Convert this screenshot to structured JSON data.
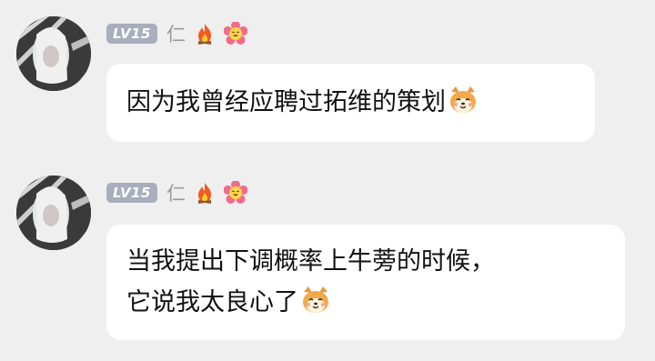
{
  "messages": [
    {
      "level": "LV15",
      "name": "仁",
      "text": "因为我曾经应聘过拓维的策划",
      "icons": [
        "fire-icon",
        "flower-smile-icon"
      ],
      "emoji": "shiba-dog-emoji"
    },
    {
      "level": "LV15",
      "name": "仁",
      "lines": [
        "当我提出下调概率上牛蒡的时候，",
        "它说我太良心了"
      ],
      "icons": [
        "fire-icon",
        "flower-smile-icon"
      ],
      "emoji": "shiba-dog-emoji"
    }
  ],
  "colors": {
    "background": "#efefef",
    "bubble": "#ffffff",
    "level_badge": "#a9aebd",
    "name": "#9a9a9a"
  }
}
